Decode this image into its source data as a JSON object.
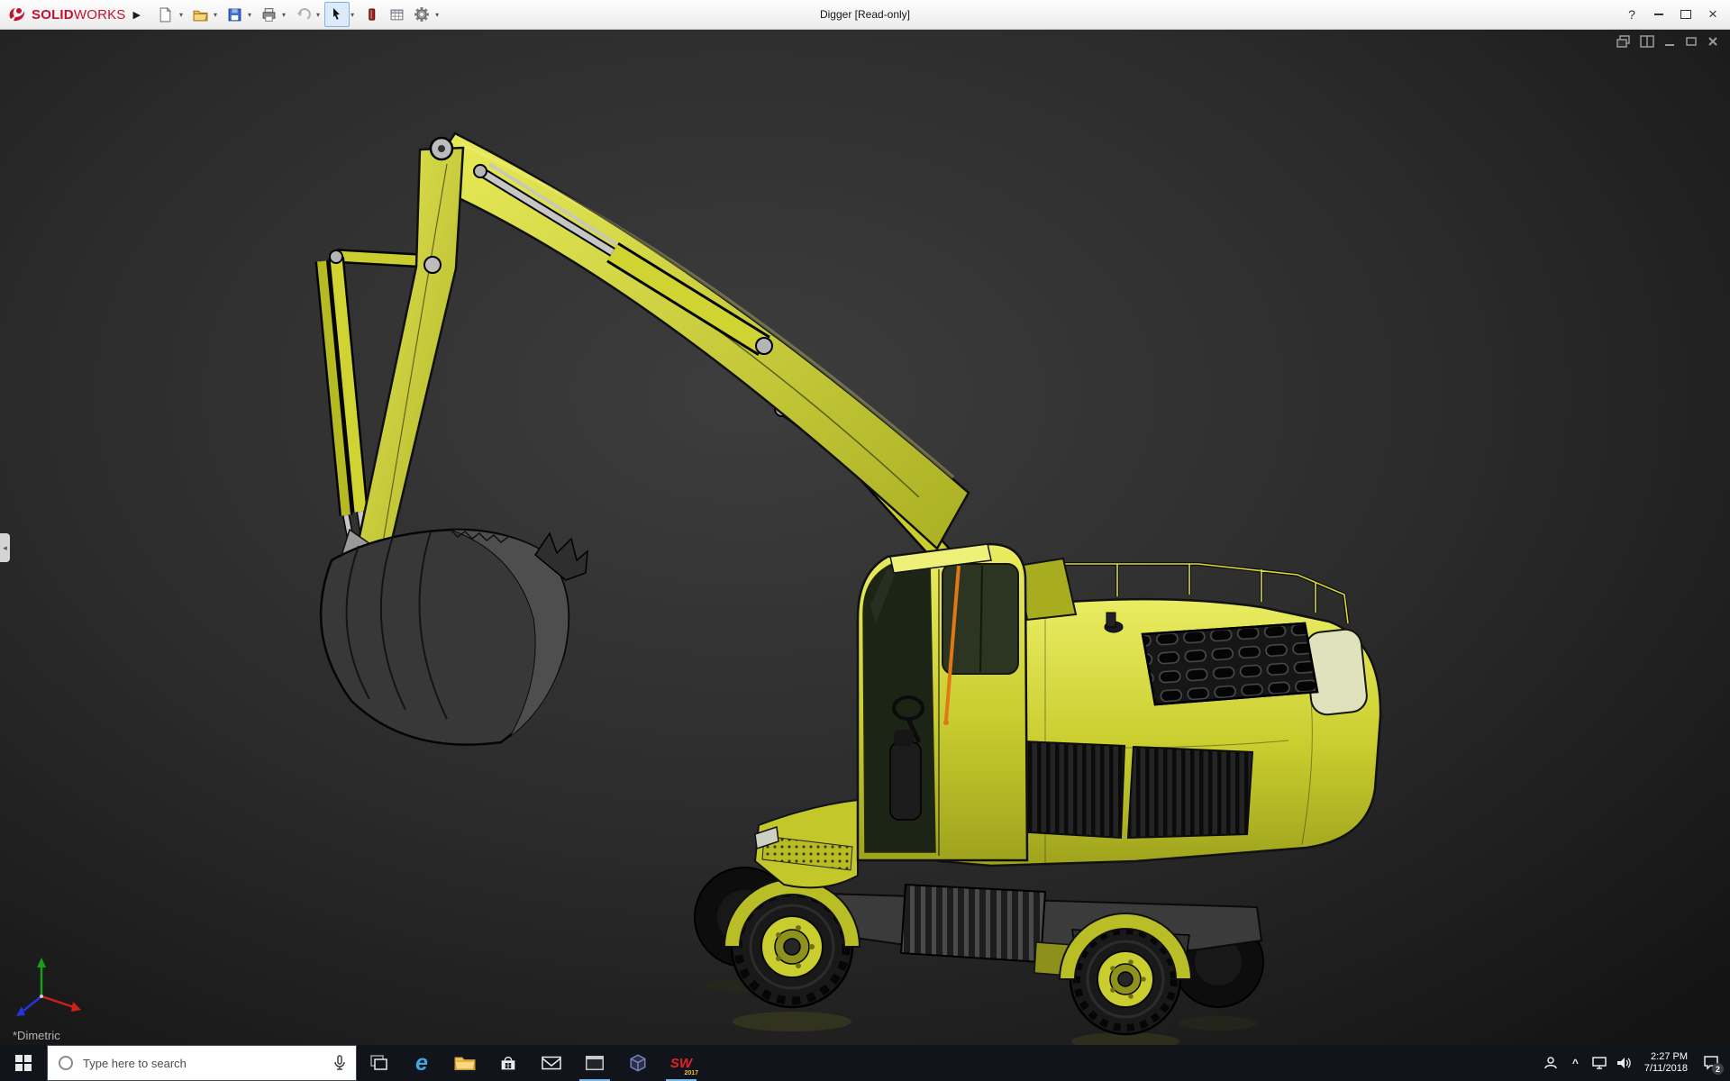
{
  "titlebar": {
    "brand_bold": "SOLID",
    "brand_light": "WORKS",
    "menu_arrow_glyph": "▶",
    "document_title": "Digger [Read-only]",
    "help_glyph": "?",
    "close_glyph": "×",
    "toolbar_icons": [
      "new-document-icon",
      "open-icon",
      "save-icon",
      "print-icon",
      "undo-icon",
      "select-arrow-icon",
      "appearance-icon",
      "design-table-icon",
      "options-gear-icon"
    ]
  },
  "viewport": {
    "orientation_label": "*Dimetric",
    "doc_window_controls": [
      "cascade-icon",
      "split-icon",
      "minimize-doc-icon",
      "restore-doc-icon",
      "close-doc-icon"
    ],
    "panel_tab_glyph": "◂",
    "model_name": "Digger excavator 3D model"
  },
  "taskbar": {
    "search_placeholder": "Type here to search",
    "edge_glyph": "e",
    "sw_glyph": "SW",
    "sw_year": "2017",
    "tray_chevron": "^",
    "time": "2:27 PM",
    "date": "7/11/2018",
    "badge": "2",
    "app_icons": [
      "start-icon",
      "search-box",
      "task-view-icon",
      "edge-icon",
      "file-explorer-icon",
      "store-icon",
      "mail-icon",
      "app-window-icon",
      "cube-app-icon",
      "solidworks-app-icon"
    ],
    "tray_icons": [
      "people-icon",
      "tray-chevron-icon",
      "network-icon",
      "volume-icon",
      "clock",
      "action-center-icon"
    ]
  },
  "colors": {
    "machine_yellow": "#c9cd2e",
    "brand_red": "#c8102e",
    "viewport_background": "#2c2c2c",
    "taskbar_background": "#11151b",
    "active_underline": "#76b9ed",
    "cab_stripe_orange": "#e07818"
  }
}
